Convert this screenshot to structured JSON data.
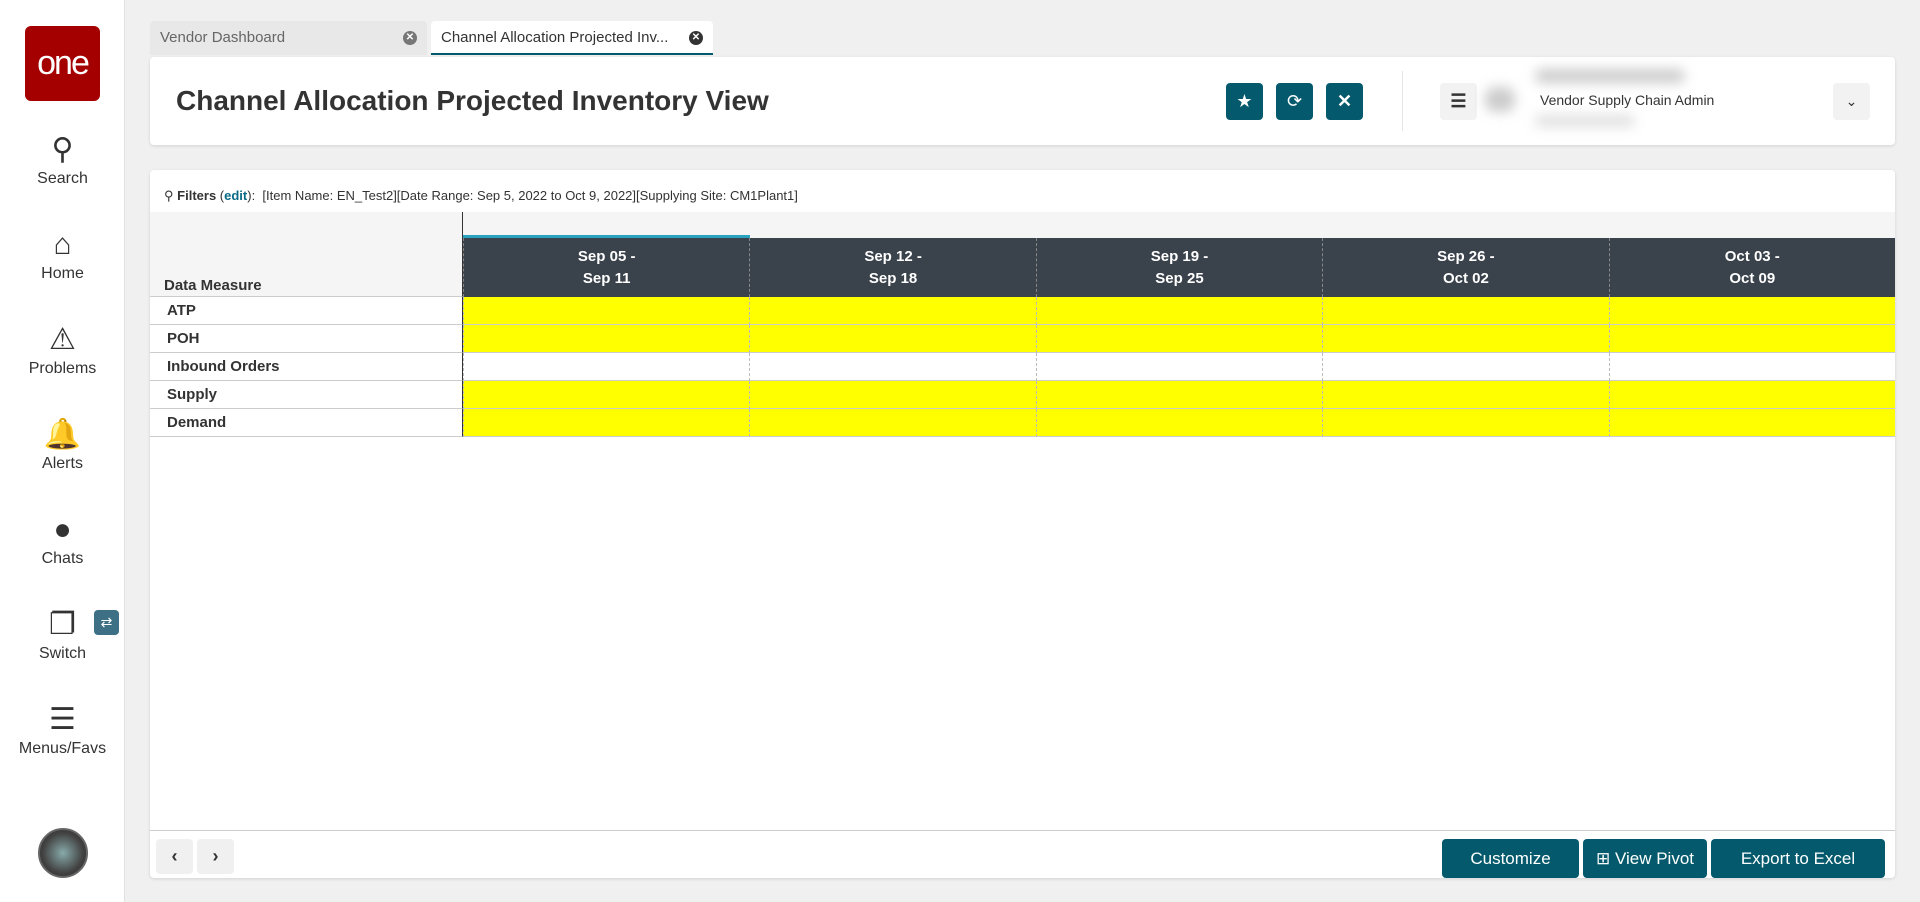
{
  "sidebar": {
    "logo": "one",
    "items": [
      {
        "label": "Search",
        "icon": "search-icon"
      },
      {
        "label": "Home",
        "icon": "home-icon"
      },
      {
        "label": "Problems",
        "icon": "warning-icon"
      },
      {
        "label": "Alerts",
        "icon": "bell-icon"
      },
      {
        "label": "Chats",
        "icon": "chat-icon"
      },
      {
        "label": "Switch",
        "icon": "switch-icon"
      },
      {
        "label": "Menus/Favs",
        "icon": "menu-icon"
      }
    ]
  },
  "tabs": [
    {
      "label": "Vendor Dashboard",
      "active": false
    },
    {
      "label": "Channel Allocation Projected Inv...",
      "active": true
    }
  ],
  "header": {
    "title": "Channel Allocation Projected Inventory View",
    "role": "Vendor Supply Chain Admin"
  },
  "filters": {
    "label": "Filters",
    "edit": "edit",
    "text": "[Item Name: EN_Test2][Date Range: Sep 5, 2022 to Oct 9, 2022][Supplying Site: CM1Plant1]"
  },
  "grid": {
    "corner": "Data Measure",
    "columns": [
      {
        "l1": "Sep 05 -",
        "l2": "Sep 11"
      },
      {
        "l1": "Sep 12 -",
        "l2": "Sep 18"
      },
      {
        "l1": "Sep 19 -",
        "l2": "Sep 25"
      },
      {
        "l1": "Sep 26 -",
        "l2": "Oct 02"
      },
      {
        "l1": "Oct 03 -",
        "l2": "Oct 09"
      }
    ],
    "rows": [
      {
        "label": "ATP",
        "highlight": true
      },
      {
        "label": "POH",
        "highlight": true
      },
      {
        "label": "Inbound Orders",
        "highlight": false
      },
      {
        "label": "Supply",
        "highlight": true
      },
      {
        "label": "Demand",
        "highlight": true
      }
    ],
    "highlight_color": "#ffff00"
  },
  "footer": {
    "customize": "Customize",
    "view_pivot": "View Pivot",
    "export": "Export to Excel"
  }
}
